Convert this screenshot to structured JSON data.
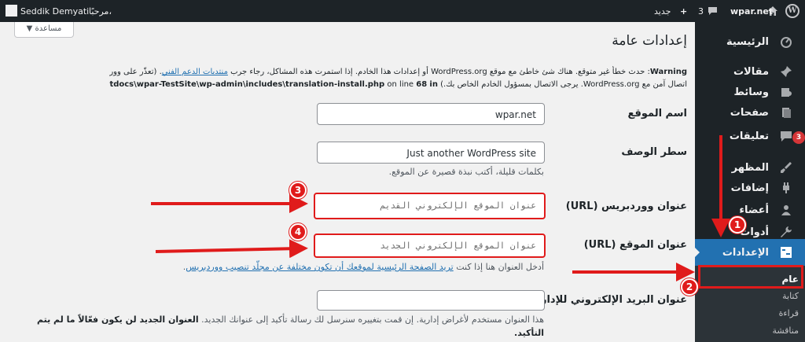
{
  "adminbar": {
    "site_name": "wpar.net",
    "comment_count": "3",
    "new_label": "جديد",
    "greeting": "مرحبًا،",
    "user_name": "Seddik Demyati"
  },
  "sidebar": {
    "items": [
      {
        "label": "الرئيسية"
      },
      {
        "label": "مقالات"
      },
      {
        "label": "وسائط"
      },
      {
        "label": "صفحات"
      },
      {
        "label": "تعليقات",
        "badge": "3"
      },
      {
        "label": "المظهر"
      },
      {
        "label": "إضافات"
      },
      {
        "label": "أعضاء"
      },
      {
        "label": "أدوات"
      },
      {
        "label": "الإعدادات"
      }
    ],
    "submenu": [
      "عام",
      "كتابة",
      "قراءة",
      "مناقشة"
    ]
  },
  "page": {
    "help_button": "مساعدة",
    "title": "إعدادات عامة",
    "warning": {
      "line1_part1": "Warning",
      "line1_part2": ": حدث خطأ غير متوقع. هناك شئ خاطئ مع موقع WordPress.org أو إعدادات هذا الخادم. إذا استمرت هذه المشاكل، رجاء جرب",
      "line1_link": "منتديات الدعم الفني",
      "line1_end": ". (تعذّر على ووردبريس تأسيس",
      "line2_part1": "اتصال آمن مع WordPress.org. يرجى الاتصال بمسؤول الخادم الخاص بك.)",
      "line2_path": "C:\\xampp\\htdocs\\wpar-TestSite\\wp-admin\\includes\\translation-install.php",
      "line2_online": "on line",
      "line2_line": "68",
      "line2_in": "in"
    },
    "fields": {
      "site_title_label": "اسم الموقع",
      "site_title_value": "wpar.net",
      "tagline_label": "سطر الوصف",
      "tagline_value": "Just another WordPress site",
      "tagline_desc": "بكلمات قليلة، أكتب نبذة قصيرة عن الموقع.",
      "wp_url_label": "عنوان ووردبريس (URL)",
      "wp_url_value": "عنوان الموقع الإلكتروني القديم",
      "site_url_label": "عنوان الموقع (URL)",
      "site_url_value": "عنوان الموقع الإلكتروني الجديد",
      "site_url_desc_part1": "أدخل العنوان هنا إذا كنت",
      "site_url_desc_link": "تريد الصفحة الرئيسية لموقعك أن تكون مختلفة عن مجلّد تنصيب ووردبريس",
      "email_label": "عنوان البريد الإلكتروني للإدارة",
      "email_desc_line1_part1": "هذا العنوان مستخدم لأغراض إدارية. إن قمت بتغييره سنرسل لك رسالة تأكيد إلى عنوانك الجديد.",
      "email_desc_line1_bold": "العنوان الجديد لن يكون فعّالاً ما لم يتم",
      "email_desc_line2_bold": "التأكيد."
    }
  },
  "annotations": [
    "1",
    "2",
    "3",
    "4"
  ],
  "colors": {
    "adminbar_bg": "#1d2327",
    "active_menu": "#2271b1",
    "annotation_red": "#e01b1b",
    "badge_red": "#d63638"
  }
}
